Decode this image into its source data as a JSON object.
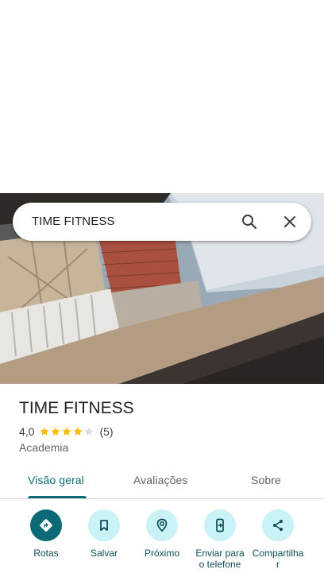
{
  "search": {
    "query": "TIME FITNESS"
  },
  "place": {
    "title": "TIME FITNESS",
    "rating": "4,0",
    "rating_stars": 4,
    "review_count": "(5)",
    "category": "Academia"
  },
  "tabs": [
    {
      "label": "Visão geral",
      "active": true
    },
    {
      "label": "Avaliações",
      "active": false
    },
    {
      "label": "Sobre",
      "active": false
    }
  ],
  "actions": [
    {
      "label": "Rotas",
      "icon": "directions-icon"
    },
    {
      "label": "Salvar",
      "icon": "bookmark-icon"
    },
    {
      "label": "Próximo",
      "icon": "nearby-icon"
    },
    {
      "label": "Enviar para o telefone",
      "icon": "send-to-phone-icon"
    },
    {
      "label": "Compartilhar",
      "icon": "share-icon"
    }
  ],
  "colors": {
    "accent": "#0b6a75",
    "action_bg": "#c9f2f6",
    "star": "#fbbc04",
    "star_empty": "#dadce0"
  }
}
